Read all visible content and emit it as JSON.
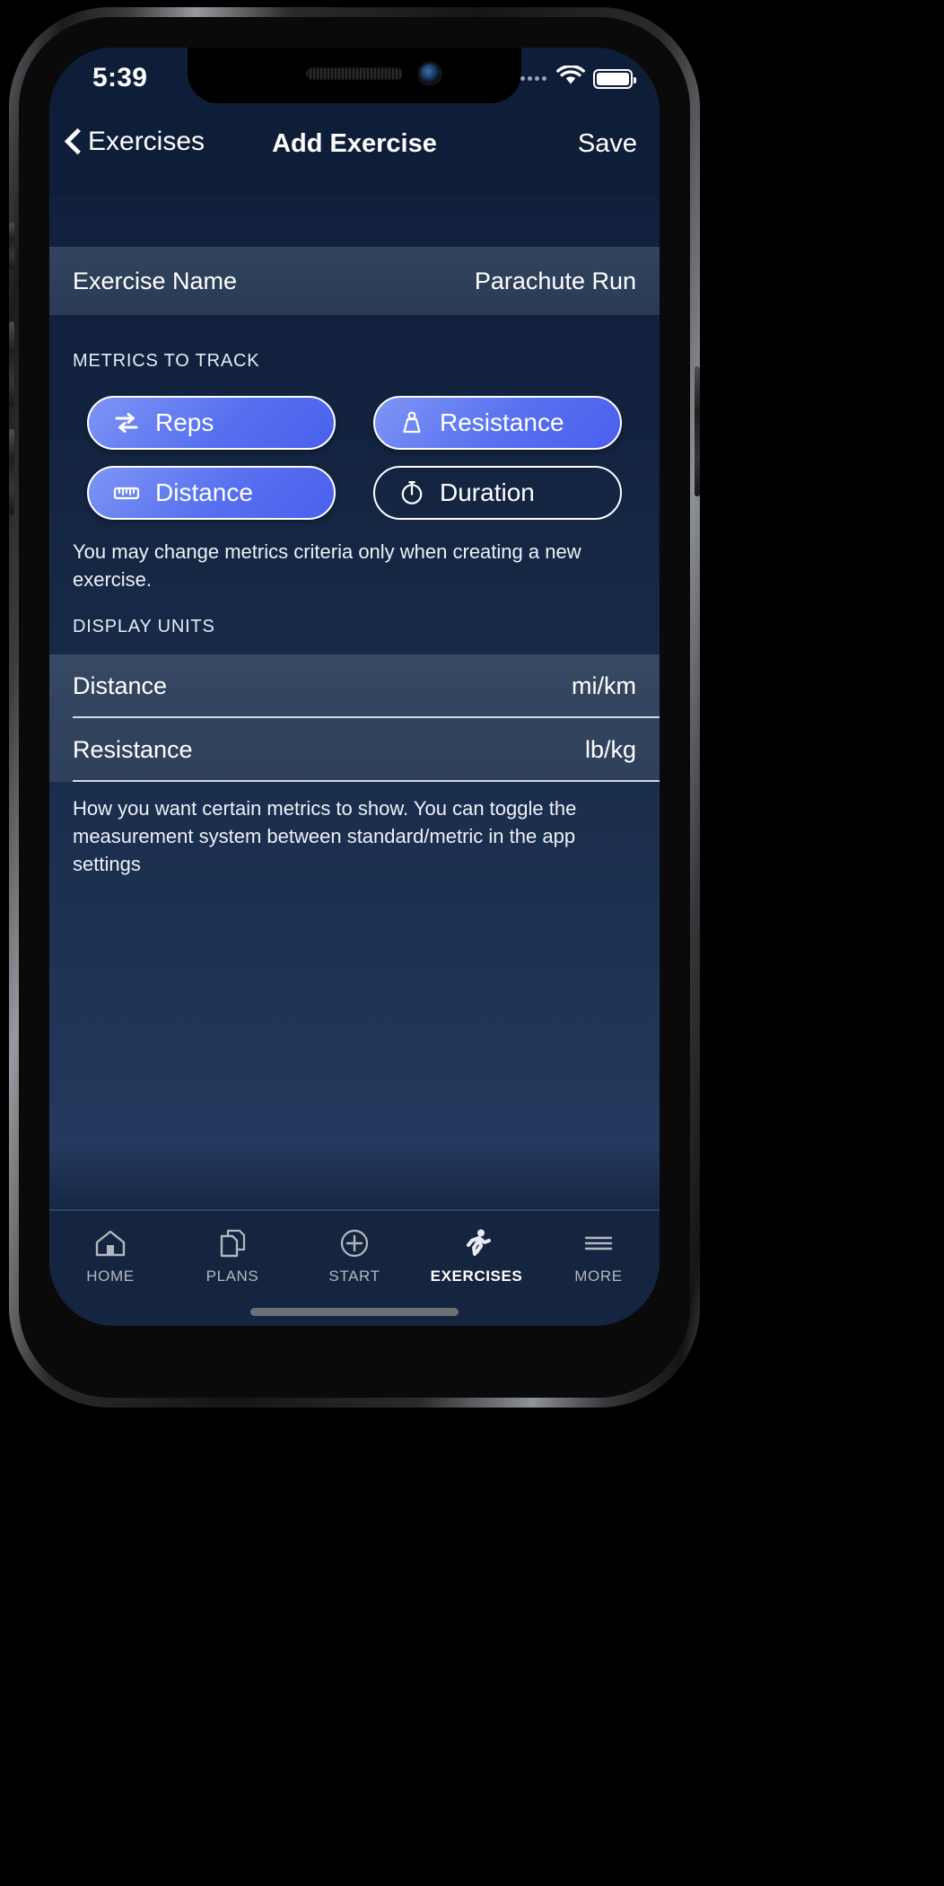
{
  "statusbar": {
    "time": "5:39",
    "wifi_icon": "wifi-icon",
    "battery_icon": "battery-full-icon",
    "signal_icon": "signal-dots-icon"
  },
  "navbar": {
    "back_label": "Exercises",
    "back_icon": "chevron-left-icon",
    "title": "Add Exercise",
    "save_label": "Save"
  },
  "exercise_name": {
    "label": "Exercise Name",
    "value": "Parachute Run"
  },
  "metrics": {
    "header": "METRICS TO TRACK",
    "note": "You may change metrics criteria only when creating a new exercise.",
    "items": [
      {
        "label": "Reps",
        "icon": "repeat-arrows-icon",
        "selected": true
      },
      {
        "label": "Resistance",
        "icon": "weight-icon",
        "selected": true
      },
      {
        "label": "Distance",
        "icon": "ruler-icon",
        "selected": true
      },
      {
        "label": "Duration",
        "icon": "stopwatch-icon",
        "selected": false
      }
    ]
  },
  "display_units": {
    "header": "DISPLAY UNITS",
    "note": "How you want certain metrics to show. You can toggle the measurement system between standard/metric in the app settings",
    "rows": [
      {
        "label": "Distance",
        "value": "mi/km"
      },
      {
        "label": "Resistance",
        "value": "lb/kg"
      }
    ]
  },
  "tabbar": {
    "items": [
      {
        "label": "HOME",
        "icon": "home-icon",
        "active": false
      },
      {
        "label": "PLANS",
        "icon": "pages-icon",
        "active": false
      },
      {
        "label": "START",
        "icon": "plus-circle-icon",
        "active": false
      },
      {
        "label": "EXERCISES",
        "icon": "runner-icon",
        "active": true
      },
      {
        "label": "MORE",
        "icon": "hamburger-icon",
        "active": false
      }
    ]
  },
  "colors": {
    "accent": "#5770ef",
    "screen_bg": "#13233f",
    "nav_bg": "#0f1e38",
    "card_bg": "#33445f",
    "tab_bg": "#15243f"
  }
}
